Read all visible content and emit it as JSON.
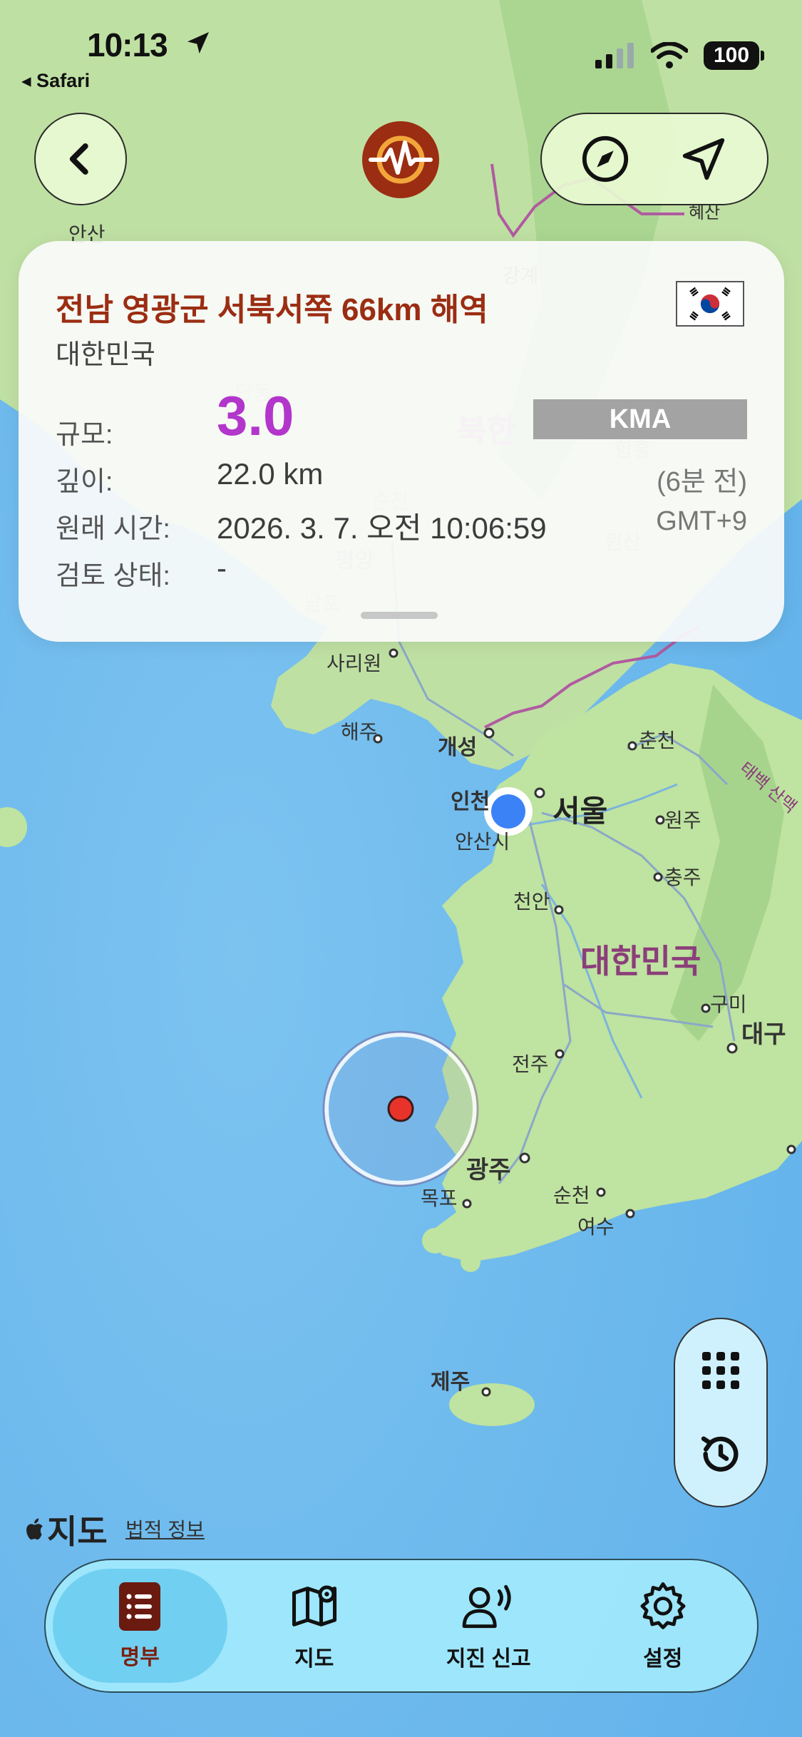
{
  "status_bar": {
    "time": "10:13",
    "back_app": "◂ Safari",
    "battery": "100"
  },
  "card": {
    "title": "전남 영광군 서북서쪽 66km 해역",
    "country": "대한민국",
    "magnitude_label": "규모:",
    "magnitude": "3.0",
    "agency": "KMA",
    "depth_label": "깊이:",
    "depth": "22.0 km",
    "time_ago": "(6분 전)",
    "origin_time_label": "원래 시간:",
    "origin_time": "2026. 3. 7. 오전 10:06:59",
    "timezone": "GMT+9",
    "review_label": "검토 상태:",
    "review_status": "-"
  },
  "map": {
    "attribution": "지도",
    "legal_link": "법적 정보",
    "labels": {
      "north_korea": "북한",
      "south_korea": "대한민국",
      "seoul": "서울",
      "pyongyang": "평양",
      "sariwon": "사리원",
      "haeju": "해주",
      "kaesong": "개성",
      "incheon": "인천",
      "ansan": "안산시",
      "chuncheon": "춘천",
      "wonju": "원주",
      "chungju": "충주",
      "cheonan": "천안",
      "gumi": "구미",
      "daegu": "대구",
      "jeonju": "전주",
      "gwangju": "광주",
      "mokpo": "목포",
      "suncheon": "순천",
      "yeosu": "여수",
      "jeju": "제주",
      "nampo": "남포",
      "gangye": "강계",
      "hamhung": "함흥",
      "wonsan": "원산",
      "danjin": "단동",
      "anshan": "안산",
      "haesan": "혜산",
      "pyongsong": "평성",
      "sunchon_n": "순천",
      "taebaek": "태백 산맥"
    }
  },
  "tabs": [
    {
      "label": "명부",
      "icon": "list-book-icon",
      "active": true
    },
    {
      "label": "지도",
      "icon": "map-icon",
      "active": false
    },
    {
      "label": "지진 신고",
      "icon": "report-person-icon",
      "active": false
    },
    {
      "label": "설정",
      "icon": "gear-icon",
      "active": false
    }
  ],
  "colors": {
    "title": "#9b2d12",
    "magnitude": "#b236cc",
    "epicenter": "#e8332a",
    "user_location": "#3b82f6"
  }
}
